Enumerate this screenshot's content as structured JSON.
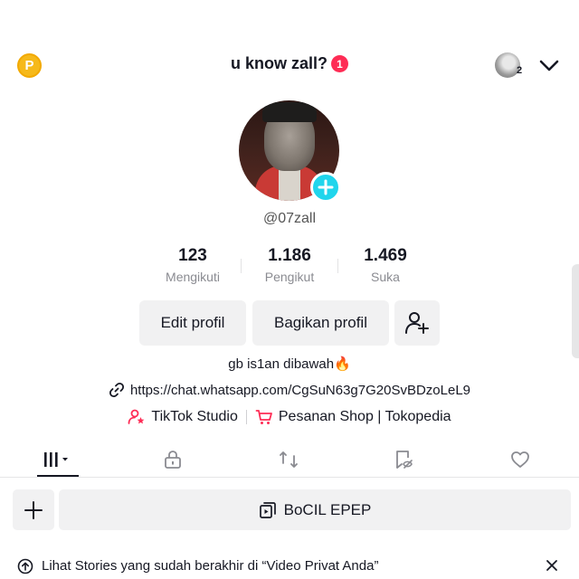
{
  "header": {
    "coin_label": "P",
    "title": "u know zall?",
    "notification_count": "1",
    "account_count": "2"
  },
  "profile": {
    "username": "@07zall",
    "stats": [
      {
        "value": "123",
        "label": "Mengikuti"
      },
      {
        "value": "1.186",
        "label": "Pengikut"
      },
      {
        "value": "1.469",
        "label": "Suka"
      }
    ],
    "edit_button": "Edit profil",
    "share_button": "Bagikan profil",
    "bio": "gb is1an dibawah🔥",
    "link": "https://chat.whatsapp.com/CgSuN63g7G20SvBDzoLeL9",
    "tools": [
      {
        "label": "TikTok Studio",
        "icon": "studio-icon"
      },
      {
        "label": "Pesanan Shop | Tokopedia",
        "icon": "cart-icon"
      }
    ]
  },
  "tabs": [
    {
      "icon": "grid-icon",
      "active": true
    },
    {
      "icon": "lock-icon",
      "active": false
    },
    {
      "icon": "repost-icon",
      "active": false
    },
    {
      "icon": "saved-icon",
      "active": false
    },
    {
      "icon": "heart-icon",
      "active": false
    }
  ],
  "playlist": {
    "name": "BoCIL EPEP"
  },
  "stories_banner": {
    "text": "Lihat Stories yang sudah berakhir di “Video Privat Anda”"
  },
  "colors": {
    "accent_red": "#fe2c55",
    "accent_cyan": "#20d5ec",
    "coin": "#f6b91a",
    "button_bg": "#f1f1f2"
  }
}
